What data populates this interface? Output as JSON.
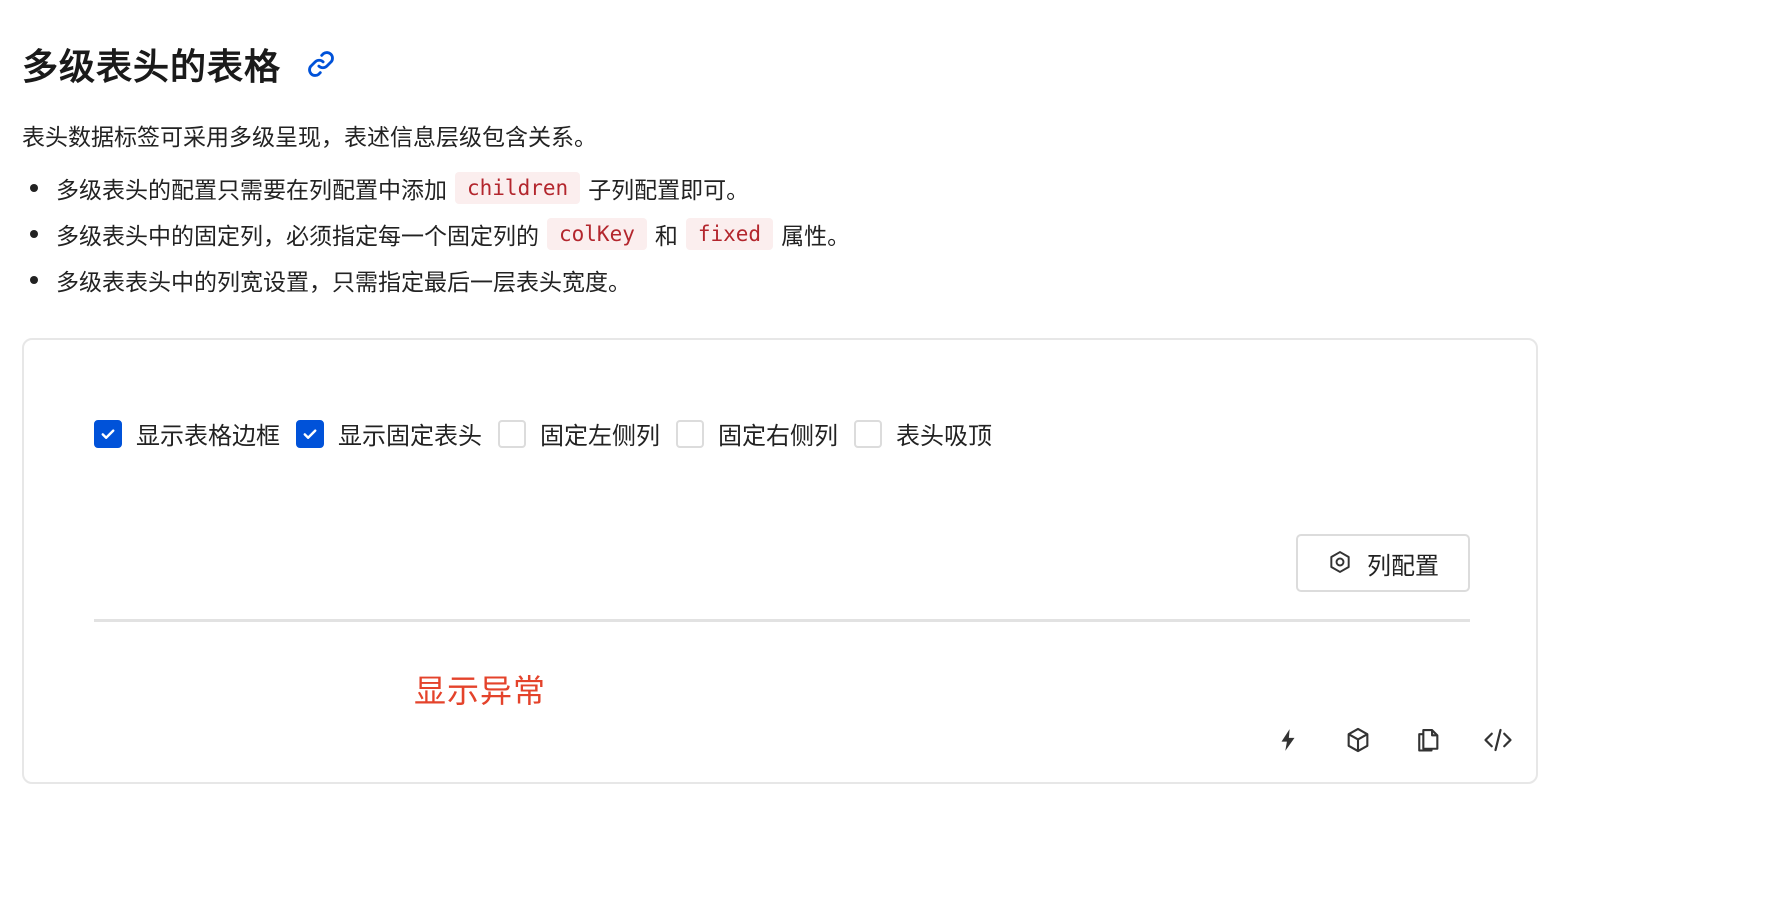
{
  "header": {
    "title": "多级表头的表格",
    "link_icon": "link-icon"
  },
  "intro": {
    "description": "表头数据标签可采用多级呈现，表述信息层级包含关系。",
    "bullets": [
      {
        "before": "多级表头的配置只需要在列配置中添加",
        "code1": "children",
        "middle": "",
        "code2": "",
        "after": "子列配置即可。"
      },
      {
        "before": "多级表头中的固定列，必须指定每一个固定列的",
        "code1": "colKey",
        "middle": "和",
        "code2": "fixed",
        "after": "属性。"
      },
      {
        "text": "多级表表头中的列宽设置，只需指定最后一层表头宽度。"
      }
    ]
  },
  "demo": {
    "options": [
      {
        "label": "显示表格边框",
        "checked": true
      },
      {
        "label": "显示固定表头",
        "checked": true
      },
      {
        "label": "固定左侧列",
        "checked": false
      },
      {
        "label": "固定右侧列",
        "checked": false
      },
      {
        "label": "表头吸顶",
        "checked": false
      }
    ],
    "column_config_button": {
      "label": "列配置",
      "icon": "hexagon-settings-icon"
    },
    "error_message": "显示异常",
    "toolbar_icons": [
      "lightning-icon",
      "cube-icon",
      "copy-icon",
      "code-icon"
    ]
  },
  "colors": {
    "primary": "#0052d9",
    "error": "#e4432b",
    "code_text": "#b3262d",
    "code_bg": "#fbeeee"
  }
}
